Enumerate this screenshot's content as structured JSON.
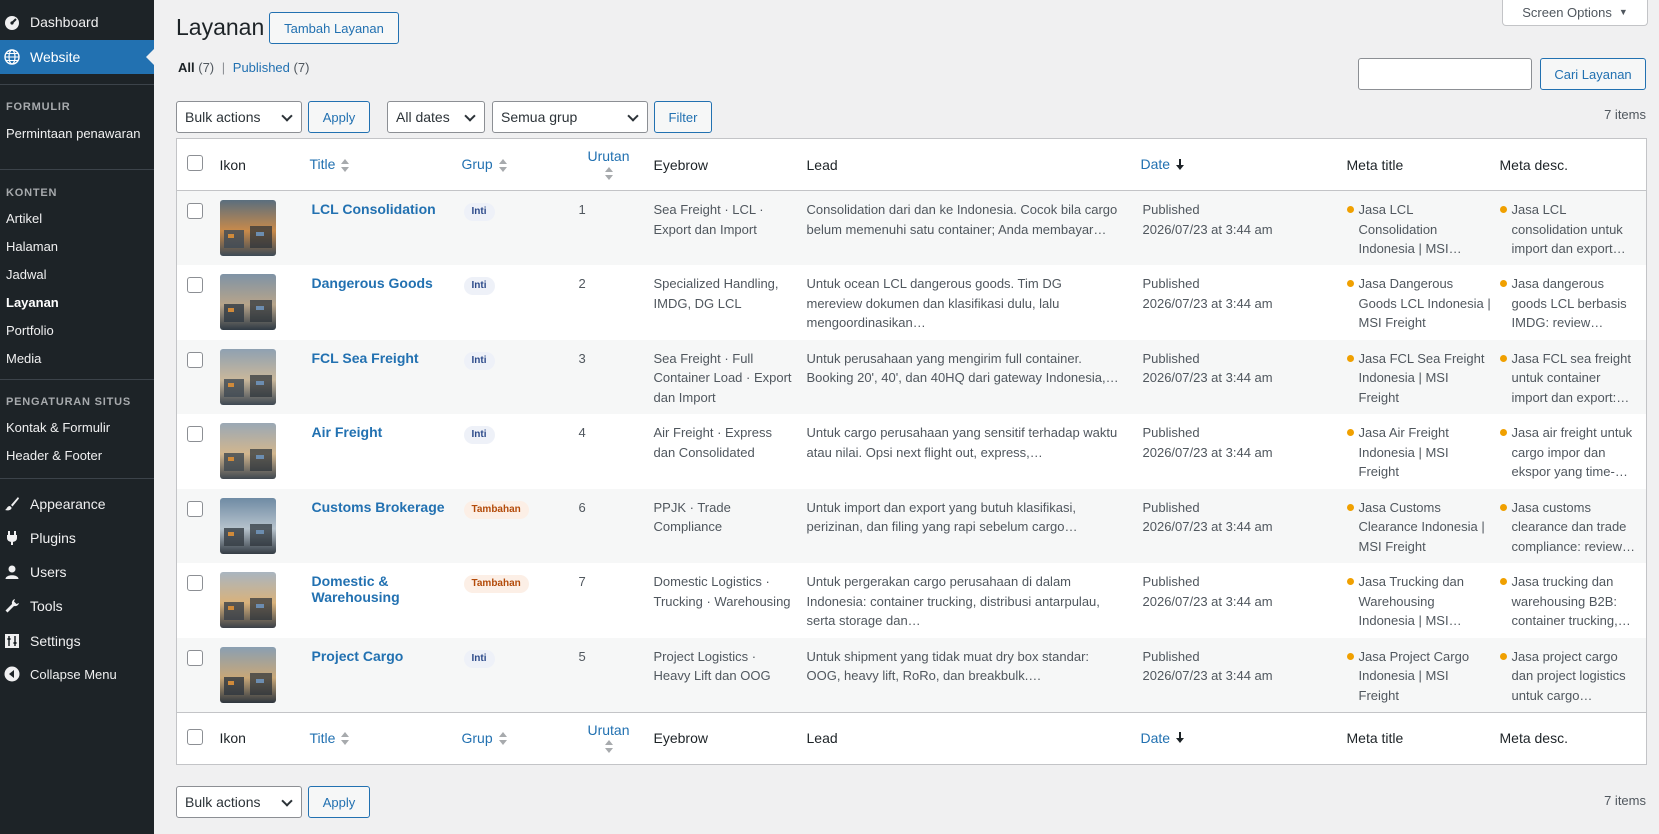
{
  "sidebar": {
    "dashboard": "Dashboard",
    "website": "Website",
    "formulir_head": "FORMULIR",
    "permintaan": "Permintaan penawaran",
    "konten_head": "KONTEN",
    "artikel": "Artikel",
    "halaman": "Halaman",
    "jadwal": "Jadwal",
    "layanan": "Layanan",
    "portfolio": "Portfolio",
    "media": "Media",
    "pengaturan_head": "PENGATURAN SITUS",
    "kontak": "Kontak & Formulir",
    "header_footer": "Header & Footer",
    "appearance": "Appearance",
    "plugins": "Plugins",
    "users": "Users",
    "tools": "Tools",
    "settings": "Settings",
    "collapse": "Collapse Menu"
  },
  "header": {
    "title": "Layanan",
    "add_button": "Tambah Layanan",
    "screen_options": "Screen Options"
  },
  "filters": {
    "all": "All",
    "all_count": "(7)",
    "separator": "|",
    "published": "Published",
    "published_count": "(7)",
    "search_value": "",
    "search_button": "Cari Layanan",
    "bulk_actions": "Bulk actions",
    "apply": "Apply",
    "all_dates": "All dates",
    "group_select": "Semua grup",
    "filter_button": "Filter",
    "items_count": "7 items"
  },
  "columns": {
    "ikon": "Ikon",
    "title": "Title",
    "grup": "Grup",
    "urutan": "Urutan",
    "eyebrow": "Eyebrow",
    "lead": "Lead",
    "date": "Date",
    "meta_title": "Meta title",
    "meta_desc": "Meta desc."
  },
  "rows": [
    {
      "title": "LCL Consolidation",
      "grup": "Inti",
      "urutan": "1",
      "eyebrow": "Sea Freight · LCL · Export dan Import",
      "lead": "Consolidation dari dan ke Indonesia. Cocok bila cargo belum memenuhi satu container; Anda membayar…",
      "status": "Published",
      "date": "2026/07/23 at 3:44 am",
      "meta_title": "Jasa LCL Consolidation Indonesia | MSI…",
      "meta_desc": "Jasa LCL consolidation untuk import dan export…"
    },
    {
      "title": "Dangerous Goods",
      "grup": "Inti",
      "urutan": "2",
      "eyebrow": "Specialized Handling, IMDG, DG LCL",
      "lead": "Untuk ocean LCL dangerous goods. Tim DG mereview dokumen dan klasifikasi dulu, lalu mengoordinasikan…",
      "status": "Published",
      "date": "2026/07/23 at 3:44 am",
      "meta_title": "Jasa Dangerous Goods LCL Indonesia | MSI Freight",
      "meta_desc": "Jasa dangerous goods LCL berbasis IMDG: review…"
    },
    {
      "title": "FCL Sea Freight",
      "grup": "Inti",
      "urutan": "3",
      "eyebrow": "Sea Freight · Full Container Load · Export dan Import",
      "lead": "Untuk perusahaan yang mengirim full container. Booking 20', 40', dan 40HQ dari gateway Indonesia,…",
      "status": "Published",
      "date": "2026/07/23 at 3:44 am",
      "meta_title": "Jasa FCL Sea Freight Indonesia | MSI Freight",
      "meta_desc": "Jasa FCL sea freight untuk container import dan export:…"
    },
    {
      "title": "Air Freight",
      "grup": "Inti",
      "urutan": "4",
      "eyebrow": "Air Freight · Express dan Consolidated",
      "lead": "Untuk cargo perusahaan yang sensitif terhadap waktu atau nilai. Opsi next flight out, express,…",
      "status": "Published",
      "date": "2026/07/23 at 3:44 am",
      "meta_title": "Jasa Air Freight Indonesia | MSI Freight",
      "meta_desc": "Jasa air freight untuk cargo impor dan ekspor yang time-…"
    },
    {
      "title": "Customs Brokerage",
      "grup": "Tambahan",
      "urutan": "6",
      "eyebrow": "PPJK · Trade Compliance",
      "lead": "Untuk import dan export yang butuh klasifikasi, perizinan, dan filing yang rapi sebelum cargo…",
      "status": "Published",
      "date": "2026/07/23 at 3:44 am",
      "meta_title": "Jasa Customs Clearance Indonesia | MSI Freight",
      "meta_desc": "Jasa customs clearance dan trade compliance: review…"
    },
    {
      "title": "Domestic & Warehousing",
      "grup": "Tambahan",
      "urutan": "7",
      "eyebrow": "Domestic Logistics · Trucking · Warehousing",
      "lead": "Untuk pergerakan cargo perusahaan di dalam Indonesia: container trucking, distribusi antarpulau, serta storage dan…",
      "status": "Published",
      "date": "2026/07/23 at 3:44 am",
      "meta_title": "Jasa Trucking dan Warehousing Indonesia | MSI…",
      "meta_desc": "Jasa trucking dan warehousing B2B: container trucking,…"
    },
    {
      "title": "Project Cargo",
      "grup": "Inti",
      "urutan": "5",
      "eyebrow": "Project Logistics · Heavy Lift dan OOG",
      "lead": "Untuk shipment yang tidak muat dry box standar: OOG, heavy lift, RoRo, dan breakbulk.…",
      "status": "Published",
      "date": "2026/07/23 at 3:44 am",
      "meta_title": "Jasa Project Cargo Indonesia | MSI Freight",
      "meta_desc": "Jasa project cargo dan project logistics untuk cargo…"
    }
  ],
  "colors": {
    "sidebar_bg": "#1d2327",
    "accent": "#2271b1",
    "inti_badge": "#2c4a8a",
    "tambahan_badge": "#b34b0a",
    "meta_dot": "#f0a000"
  }
}
